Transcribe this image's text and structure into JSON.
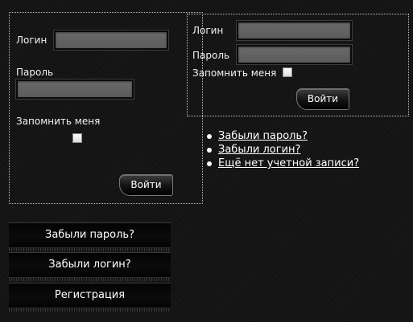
{
  "left_form": {
    "login_label": "Логин",
    "password_label": "Пароль",
    "remember_label": "Запомнить меня",
    "login_value": "",
    "password_value": "",
    "remember_checked": false,
    "submit_label": "Войти"
  },
  "right_form": {
    "login_label": "Логин",
    "password_label": "Пароль",
    "remember_label": "Запомнить меня",
    "login_value": "",
    "password_value": "",
    "remember_checked": false,
    "submit_label": "Войти"
  },
  "links": [
    {
      "label": "Забыли пароль?"
    },
    {
      "label": "Забыли логин?"
    },
    {
      "label": "Ещё нет учетной записи?"
    }
  ],
  "menu": [
    {
      "label": "Забыли пароль?"
    },
    {
      "label": "Забыли логин?"
    },
    {
      "label": "Регистрация"
    }
  ],
  "colors": {
    "background": "#161616",
    "field": "#5f5f5f",
    "border_dotted": "#bdbdbd",
    "text": "#ffffff"
  }
}
